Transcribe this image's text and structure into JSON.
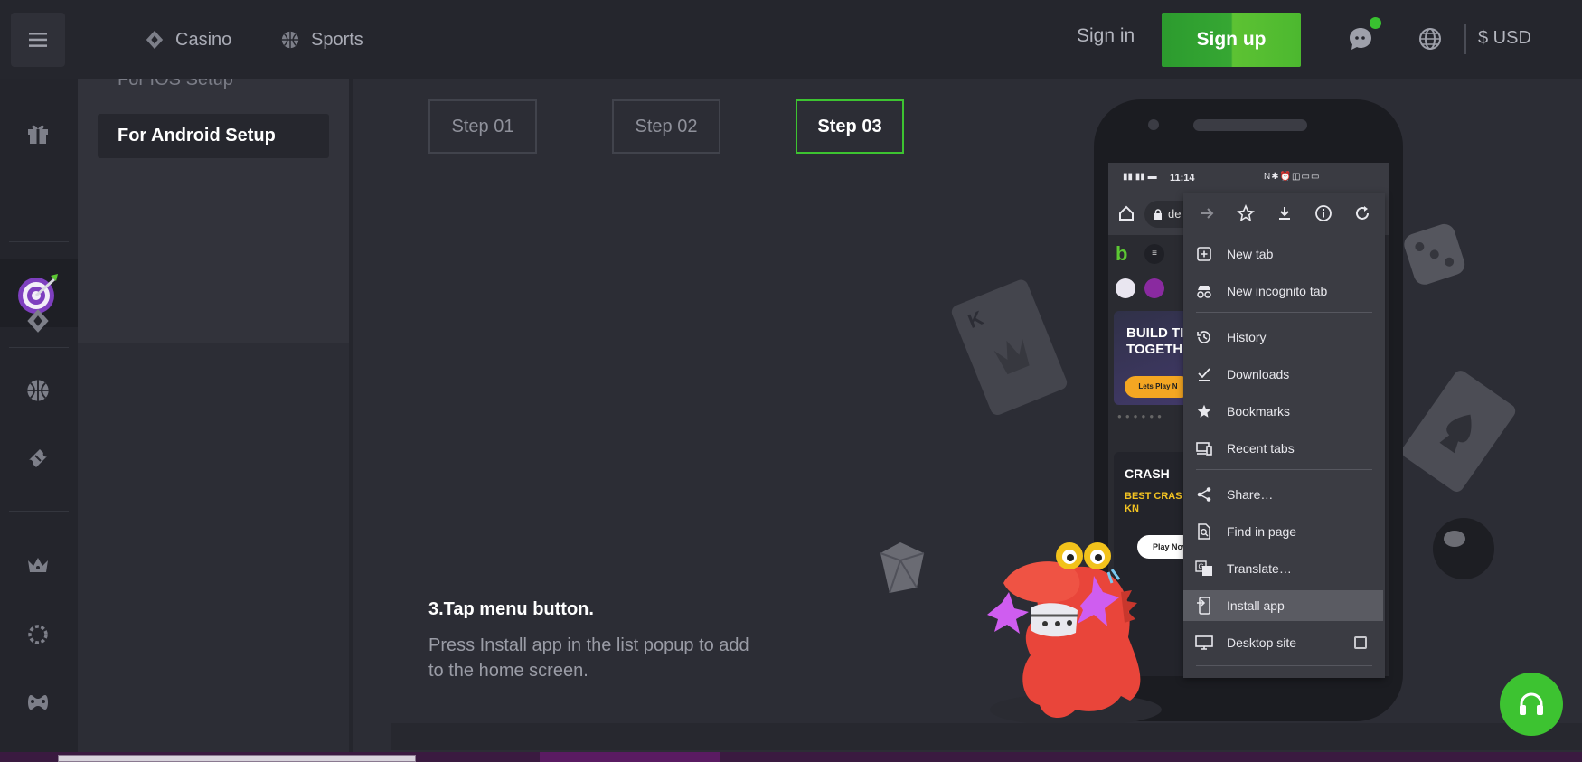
{
  "header": {
    "nav": [
      {
        "label": "Casino",
        "icon": "diamond-card-icon"
      },
      {
        "label": "Sports",
        "icon": "basketball-icon"
      }
    ],
    "sign_in": "Sign in",
    "sign_up": "Sign up",
    "currency": "$ USD",
    "colors": {
      "signup": "#36a733",
      "online_dot": "#39c130"
    }
  },
  "rail": {
    "icons": [
      "gift-icon",
      "target-dart-icon",
      "diamond-card-icon",
      "basketball-icon",
      "ticket-icon",
      "crown-icon",
      "settings-ring-icon",
      "gamepad-icon"
    ]
  },
  "setup_menu": {
    "items": [
      {
        "label": "For IOS Setup",
        "active": false
      },
      {
        "label": "For Android Setup",
        "active": true
      }
    ]
  },
  "steps": [
    {
      "label": "Step 01",
      "active": false
    },
    {
      "label": "Step 02",
      "active": false
    },
    {
      "label": "Step 03",
      "active": true
    }
  ],
  "instruction": {
    "title": "3.Tap menu button.",
    "text": "Press Install app in the list popup to add to the home screen."
  },
  "phone": {
    "time": "11:14",
    "url_partial": "de",
    "banner1_text": "BUILD TI TOGETH",
    "banner1_button": "Lets Play N",
    "banner2_title": "CRASH",
    "banner2_sub": "BEST CRAS U EVER KN",
    "banner2_button": "Play Now",
    "menu": [
      {
        "label": "New tab",
        "icon": "plus-box-icon"
      },
      {
        "label": "New incognito tab",
        "icon": "incognito-icon"
      },
      {
        "label": "History",
        "icon": "history-icon"
      },
      {
        "label": "Downloads",
        "icon": "download-check-icon"
      },
      {
        "label": "Bookmarks",
        "icon": "star-icon"
      },
      {
        "label": "Recent tabs",
        "icon": "devices-icon"
      },
      {
        "label": "Share…",
        "icon": "share-icon"
      },
      {
        "label": "Find in page",
        "icon": "find-icon"
      },
      {
        "label": "Translate…",
        "icon": "translate-icon"
      },
      {
        "label": "Install app",
        "icon": "install-app-icon",
        "highlighted": true
      },
      {
        "label": "Desktop site",
        "icon": "desktop-icon",
        "checkbox": true
      }
    ]
  },
  "accent_color": "#3dc331"
}
